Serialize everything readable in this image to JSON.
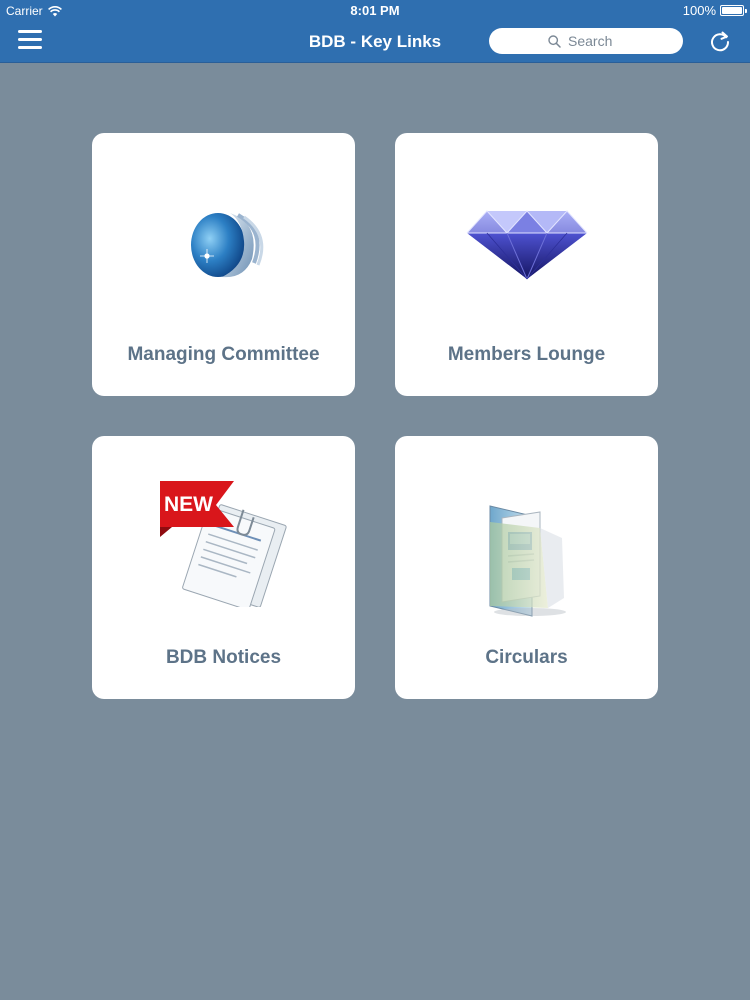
{
  "status_bar": {
    "carrier": "Carrier",
    "time": "8:01 PM",
    "battery": "100%"
  },
  "nav": {
    "title": "BDB - Key Links",
    "search_placeholder": "Search",
    "menu_icon": "hamburger-menu-icon",
    "refresh_icon": "refresh-icon"
  },
  "tiles": [
    {
      "label": "Managing Committee",
      "icon": "globe-logo-icon"
    },
    {
      "label": "Members Lounge",
      "icon": "diamond-icon"
    },
    {
      "label": "BDB Notices",
      "icon": "new-notice-icon",
      "badge": "NEW"
    },
    {
      "label": "Circulars",
      "icon": "folder-icon"
    }
  ],
  "colors": {
    "nav_bar": "#2f6fb0",
    "background": "#7a8c9b",
    "tile_label": "#5d7388"
  }
}
